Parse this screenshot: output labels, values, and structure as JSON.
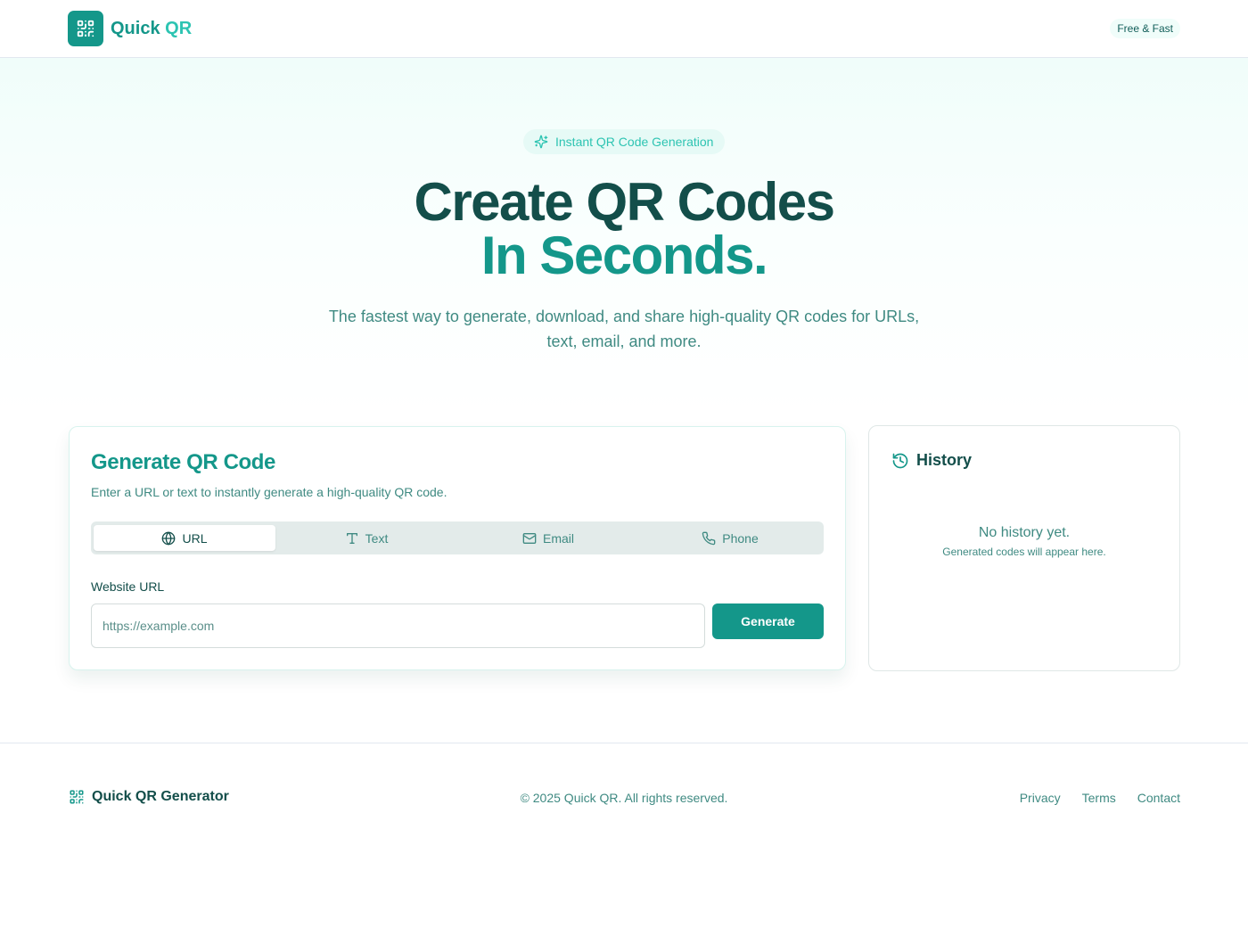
{
  "header": {
    "brand_prefix": "Quick",
    "brand_accent": "QR",
    "badge": "Free & Fast"
  },
  "hero": {
    "pill": "Instant QR Code Generation",
    "title_line1": "Create QR Codes",
    "title_line2": "In Seconds.",
    "subtitle": "The fastest way to generate, download, and share high-quality QR codes for URLs, text, email, and more."
  },
  "generator": {
    "title": "Generate QR Code",
    "description": "Enter a URL or text to instantly generate a high-quality QR code.",
    "tabs": [
      {
        "label": "URL",
        "icon": "globe-icon",
        "active": true
      },
      {
        "label": "Text",
        "icon": "text-icon",
        "active": false
      },
      {
        "label": "Email",
        "icon": "mail-icon",
        "active": false
      },
      {
        "label": "Phone",
        "icon": "phone-icon",
        "active": false
      }
    ],
    "field_label": "Website URL",
    "input_value": "",
    "input_placeholder": "https://example.com",
    "button_label": "Generate"
  },
  "history": {
    "title": "History",
    "empty": "No history yet.",
    "hint": "Generated codes will appear here."
  },
  "footer": {
    "brand": "Quick QR Generator",
    "copyright": "© 2025 Quick QR. All rights reserved.",
    "links": [
      "Privacy",
      "Terms",
      "Contact"
    ]
  },
  "colors": {
    "primary": "#14978a",
    "accent": "#2dc4b2",
    "dark": "#134e4a",
    "muted": "#3f8a82"
  }
}
